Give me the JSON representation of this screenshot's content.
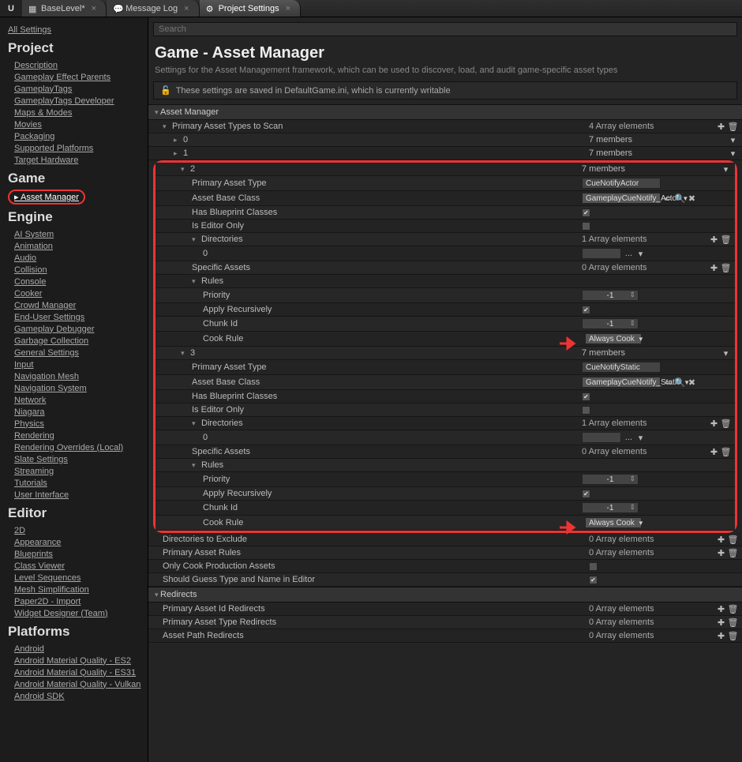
{
  "tabs": {
    "t0": "BaseLevel*",
    "t1": "Message Log",
    "t2": "Project Settings"
  },
  "search": {
    "placeholder": "Search"
  },
  "header": {
    "title": "Game - Asset Manager",
    "subtitle": "Settings for the Asset Management framework, which can be used to discover, load, and audit game-specific asset types",
    "info": "These settings are saved in DefaultGame.ini, which is currently writable"
  },
  "sidebar": {
    "all": "All Settings",
    "project_h": "Project",
    "project": [
      "Description",
      "Gameplay Effect Parents",
      "GameplayTags",
      "GameplayTags Developer",
      "Maps & Modes",
      "Movies",
      "Packaging",
      "Supported Platforms",
      "Target Hardware"
    ],
    "game_h": "Game",
    "game": [
      "Asset Manager"
    ],
    "engine_h": "Engine",
    "engine": [
      "AI System",
      "Animation",
      "Audio",
      "Collision",
      "Console",
      "Cooker",
      "Crowd Manager",
      "End-User Settings",
      "Gameplay Debugger",
      "Garbage Collection",
      "General Settings",
      "Input",
      "Navigation Mesh",
      "Navigation System",
      "Network",
      "Niagara",
      "Physics",
      "Rendering",
      "Rendering Overrides (Local)",
      "Slate Settings",
      "Streaming",
      "Tutorials",
      "User Interface"
    ],
    "editor_h": "Editor",
    "editor": [
      "2D",
      "Appearance",
      "Blueprints",
      "Class Viewer",
      "Level Sequences",
      "Mesh Simplification",
      "Paper2D - Import",
      "Widget Designer (Team)"
    ],
    "platforms_h": "Platforms",
    "platforms": [
      "Android",
      "Android Material Quality - ES2",
      "Android Material Quality - ES31",
      "Android Material Quality - Vulkan",
      "Android SDK"
    ]
  },
  "sections": {
    "s0": "Asset Manager",
    "s1": "Redirects"
  },
  "labels": {
    "pats": "Primary Asset Types to Scan",
    "pat": "Primary Asset Type",
    "abc": "Asset Base Class",
    "hbc": "Has Blueprint Classes",
    "ieo": "Is Editor Only",
    "dirs": "Directories",
    "specs": "Specific Assets",
    "rules": "Rules",
    "prio": "Priority",
    "apprec": "Apply Recursively",
    "chunk": "Chunk Id",
    "cookr": "Cook Rule",
    "excl": "Directories to Exclude",
    "par": "Primary Asset Rules",
    "ocpa": "Only Cook Production Assets",
    "sgtne": "Should Guess Type and Name in Editor",
    "paidr": "Primary Asset Id Redirects",
    "patr": "Primary Asset Type Redirects",
    "apr": "Asset Path Redirects"
  },
  "values": {
    "arr4": "4 Array elements",
    "arr1": "1 Array elements",
    "arr0": "0 Array elements",
    "mem7": "7 members",
    "n0": "0",
    "n1": "1",
    "n2": "2",
    "n3": "3",
    "actor_type": "CueNotifyActor",
    "actor_class": "GameplayCueNotify_Actor",
    "static_type": "CueNotifyStatic",
    "static_class": "GameplayCueNotify_Static",
    "neg1": "-1",
    "always": "Always Cook",
    "ellipsis": "...",
    "check": "✔"
  }
}
